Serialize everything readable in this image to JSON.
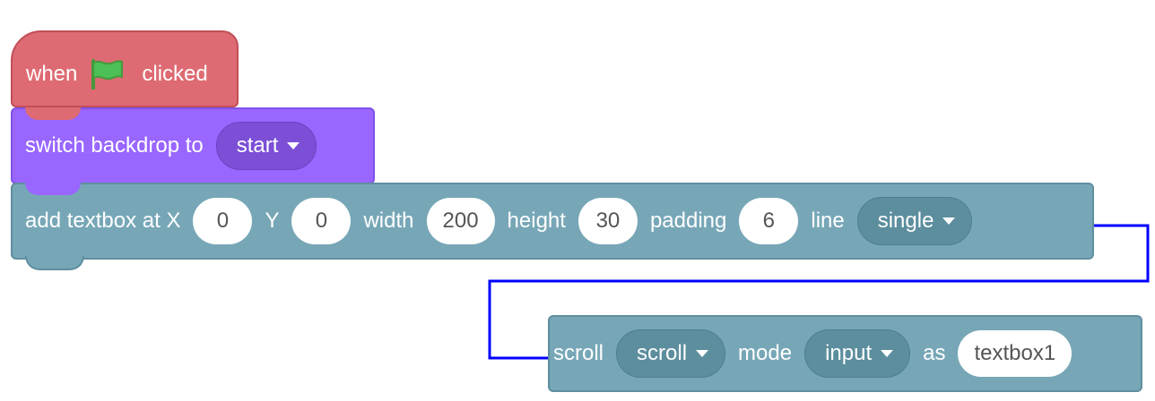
{
  "hat_block": {
    "prefix": "when",
    "suffix": "clicked",
    "color": "#de6b73"
  },
  "looks_block": {
    "label": "switch backdrop to",
    "backdrop": "start",
    "color": "#9966ff"
  },
  "textbox_block": {
    "label_x": "add textbox at X",
    "x": "0",
    "label_y": "Y",
    "y": "0",
    "label_width": "width",
    "width": "200",
    "label_height": "height",
    "height": "30",
    "label_padding": "padding",
    "padding": "6",
    "label_line": "line",
    "line": "single",
    "color": "#77a7b7"
  },
  "scroll_block": {
    "label_scroll": "scroll",
    "scroll": "scroll",
    "label_mode": "mode",
    "mode": "input",
    "label_as": "as",
    "as": "textbox1"
  },
  "connector_color": "#0000ff"
}
